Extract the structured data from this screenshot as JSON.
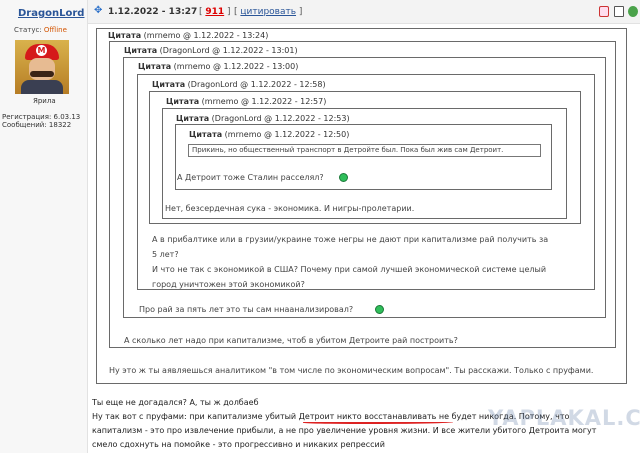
{
  "author": {
    "name": "DragonLord",
    "status_label": "Статус:",
    "status_value": "Offline",
    "avatar_caption": "Ярила",
    "registration": "Регистрация: 6.03.13",
    "messages": "Сообщений: 18322"
  },
  "header": {
    "date": "1.12.2022 - 13:27",
    "post_number": "911",
    "quote_link": "цитировать"
  },
  "quotes": [
    {
      "label": "Цитата",
      "meta": "(mrnemo @ 1.12.2022 - 13:24)",
      "reply": "Ну это ж ты аявляешься аналитиком \"в том числе по экономическим вопросам\". Ты расскажи. Только с пруфами."
    },
    {
      "label": "Цитата",
      "meta": "(DragonLord @ 1.12.2022 - 13:01)",
      "reply": "А сколько лет надо при капитализме, чтоб в убитом Детроите рай построить?"
    },
    {
      "label": "Цитата",
      "meta": "(mrnemo @ 1.12.2022 - 13:00)",
      "reply": "Про рай за пять лет это ты сам ннаанализировал?"
    },
    {
      "label": "Цитата",
      "meta": "(DragonLord @ 1.12.2022 - 12:58)",
      "reply_lines": [
        "А в прибалтике или в грузии/украине тоже негры не дают при капитализме рай получить за",
        "5 лет?",
        "И что не так с экономикой в США? Почему при самой лучшей экономической системе целый",
        "город уничтожен этой экономикой?"
      ]
    },
    {
      "label": "Цитата",
      "meta": "(mrnemo @ 1.12.2022 - 12:57)",
      "reply": "Нет, безсердечная сука - экономика. И нигры-пролетарии."
    },
    {
      "label": "Цитата",
      "meta": "(DragonLord @ 1.12.2022 - 12:53)",
      "reply": "А Детроит тоже Сталин расселял?"
    },
    {
      "label": "Цитата",
      "meta": "(mrnemo @ 1.12.2022 - 12:50)",
      "reply": "Прикинь, но общественный транспорт в Детройте был. Пока был жив сам Детроит."
    }
  ],
  "post": {
    "lines": [
      "Ты еще не догадался? А, ты ж долбаеб",
      "Ну так вот с пруфами: при капитализме убитый Детроит никто восстанавливать не будет никогда. Потому, что",
      "капитализм - это про извлечение прибыли, а не про увеличение уровня жизни. И все жители убитого Детроита могут",
      "смело сдохнуть на помойке - это прогрессивно и никаких репрессий"
    ]
  },
  "watermark": "YAPLAKAL.COM",
  "icons": [
    "pin-icon",
    "report-icon",
    "edit-icon",
    "status-icon",
    "smiley-icon"
  ],
  "colors": {
    "author_link": "#2a5598",
    "offline": "#d35400",
    "post_number": "#dd0000"
  }
}
